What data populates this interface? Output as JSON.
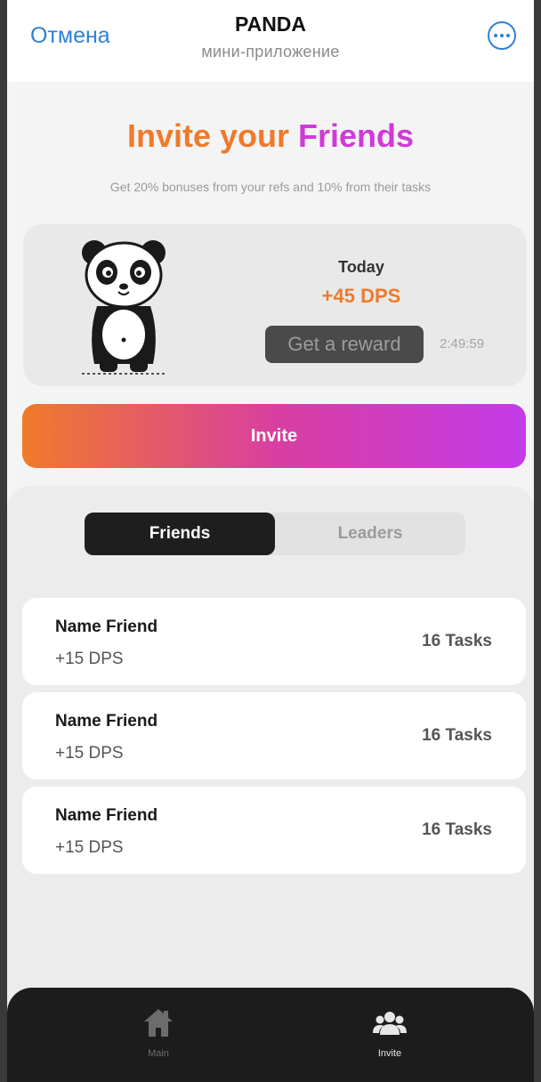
{
  "header": {
    "cancel_label": "Отмена",
    "title": "PANDA",
    "subtitle": "мини-приложение",
    "more_icon": "more-horizontal-circle-icon"
  },
  "hero": {
    "title_part_a": "Invite your ",
    "title_part_b": "Friends",
    "subtitle": "Get 20% bonuses from your refs and 10% from their tasks"
  },
  "reward_card": {
    "today_label": "Today",
    "today_dps": "+45 DPS",
    "reward_button_label": "Get a reward",
    "timer": "2:49:59"
  },
  "invite_button_label": "Invite",
  "tabs": [
    {
      "label": "Friends",
      "active": true
    },
    {
      "label": "Leaders",
      "active": false
    }
  ],
  "friends": [
    {
      "name": "Name Friend",
      "dps": "+15 DPS",
      "tasks": "16 Tasks"
    },
    {
      "name": "Name Friend",
      "dps": "+15 DPS",
      "tasks": "16 Tasks"
    },
    {
      "name": "Name Friend",
      "dps": "+15 DPS",
      "tasks": "16 Tasks"
    }
  ],
  "bottom_nav": [
    {
      "label": "Main",
      "icon": "home-icon",
      "active": false
    },
    {
      "label": "Invite",
      "icon": "users-icon",
      "active": true
    }
  ],
  "colors": {
    "accent_blue": "#2f80d8",
    "gradient_start": "#f07a2a",
    "gradient_end": "#c43bea",
    "dark": "#1e1e1e"
  }
}
